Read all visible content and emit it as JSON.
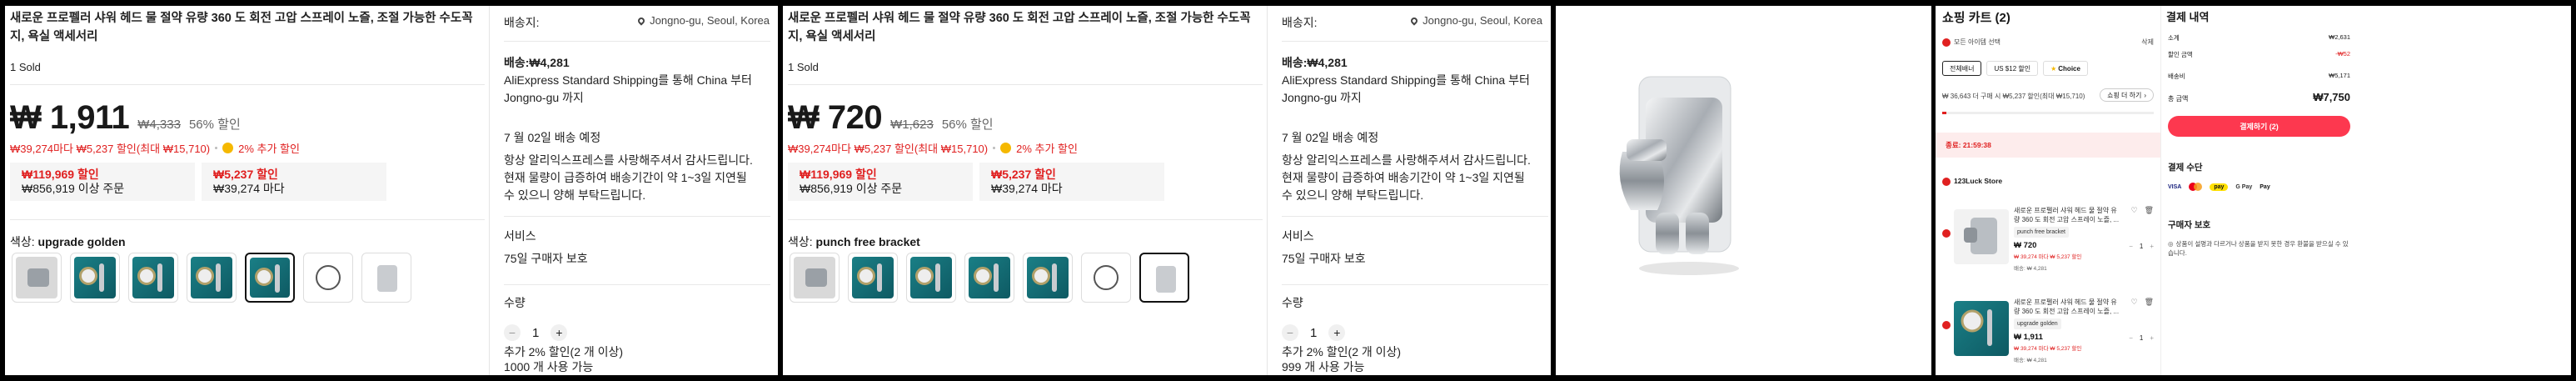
{
  "product_a": {
    "title": "새로운 프로펠러 샤워 헤드 물 절약 유량 360 도 회전 고압 스프레이 노즐, 조절 가능한 수도꼭지, 욕실 액세서리",
    "sold": "1 Sold",
    "price": "₩ 1,911",
    "original_price": "₩4,333",
    "discount": "56% 할인",
    "promo": "₩39,274마다 ₩5,237 할인(최대 ₩15,710)",
    "coin_promo": "2% 추가 할인",
    "coupons": [
      {
        "amount": "₩119,969 할인",
        "condition": "₩856,919 이상 주문"
      },
      {
        "amount": "₩5,237 할인",
        "condition": "₩39,274 마다"
      }
    ],
    "color_label": "색상:",
    "color_value": "upgrade golden",
    "ship_to_label": "배송지:",
    "location": "Jongno-gu, Seoul, Korea",
    "shipping_fee": "배송:₩4,281",
    "shipping_method": "AliExpress Standard Shipping를 통해 China 부터Jongno-gu 까지",
    "delivery_date": "7 월 02일 배송 예정",
    "delivery_note": "항상 알리익스프레스를 사랑해주셔서 감사드립니다. 현재 물량이 급증하여 배송기간이 약 1~3일 지연될 수 있으니 양해 부탁드립니다.",
    "service_label": "서비스",
    "service_value": "75일 구매자 보호",
    "qty_label": "수량",
    "qty": "1",
    "qty_promo": "추가 2% 할인(2 개 이상)",
    "qty_available": "1000 개 사용 가능"
  },
  "product_b": {
    "title": "새로운 프로펠러 샤워 헤드 물 절약 유량 360 도 회전 고압 스프레이 노즐, 조절 가능한 수도꼭지, 욕실 액세서리",
    "sold": "1 Sold",
    "price": "₩ 720",
    "original_price": "₩1,623",
    "discount": "56% 할인",
    "promo": "₩39,274마다 ₩5,237 할인(최대 ₩15,710)",
    "coin_promo": "2% 추가 할인",
    "coupons": [
      {
        "amount": "₩119,969 할인",
        "condition": "₩856,919 이상 주문"
      },
      {
        "amount": "₩5,237 할인",
        "condition": "₩39,274 마다"
      }
    ],
    "color_label": "색상:",
    "color_value": "punch free bracket",
    "ship_to_label": "배송지:",
    "location": "Jongno-gu, Seoul, Korea",
    "shipping_fee": "배송:₩4,281",
    "shipping_method": "AliExpress Standard Shipping를 통해 China 부터Jongno-gu 까지",
    "delivery_date": "7 월 02일 배송 예정",
    "delivery_note": "항상 알리익스프레스를 사랑해주셔서 감사드립니다. 현재 물량이 급증하여 배송기간이 약 1~3일 지연될 수 있으니 양해 부탁드립니다.",
    "service_label": "서비스",
    "service_value": "75일 구매자 보호",
    "qty_label": "수량",
    "qty": "1",
    "qty_promo": "추가 2% 할인(2 개 이상)",
    "qty_available": "999 개 사용 가능"
  },
  "cart": {
    "title": "쇼핑 카트 (2)",
    "select_all": "모든 아이템 선택",
    "delete": "삭제",
    "tabs": [
      "전체배너",
      "US $12 할인",
      "Choice"
    ],
    "progress_text": "₩ 36,643 더 구매 시 ₩5,237 할인(최대 ₩15,710)",
    "progress_button": "쇼핑 더 하기",
    "progress_fraction": 0.02,
    "timer": "종료: 21:59:38",
    "store": "123Luck Store",
    "items": [
      {
        "title": "새로운 프로펠러 샤워 헤드 물 절약 유량 360 도 회전 고압 스프레이 노즐, ...",
        "variant": "punch free bracket",
        "price": "₩ 720",
        "promo": "₩ 39,274 마다 ₩ 5,237 할인",
        "shipping": "배송: ₩ 4,281",
        "qty": "1"
      },
      {
        "title": "새로운 프로펠러 샤워 헤드 물 절약 유량 360 도 회전 고압 스프레이 노즐, ...",
        "variant": "upgrade golden",
        "price": "₩ 1,911",
        "promo": "₩ 39,274 마다 ₩ 5,237 할인",
        "shipping": "배송: ₩ 4,281",
        "qty": "1"
      }
    ]
  },
  "summary": {
    "title": "결제 내역",
    "rows": [
      {
        "label": "소계",
        "value": "₩2,631"
      },
      {
        "label": "할인 금액",
        "value": "-₩52"
      },
      {
        "label": "배송비",
        "value": "₩5,171"
      }
    ],
    "total_label": "총 금액",
    "total_value": "₩7,750",
    "pay_button": "결제하기 (2)",
    "payment_heading": "결제 수단",
    "payment_methods": [
      "VISA",
      "mastercard",
      "pay",
      "G Pay",
      "Pay"
    ],
    "protection_heading": "구매자 보호",
    "protection_text": "상품이 설명과 다르거나 상품을 받지 못한 경우 환불을 받으실 수 있습니다."
  },
  "colors": {
    "accent_red": "#e02020",
    "pay_button": "#fd384f",
    "background": "#000000"
  }
}
